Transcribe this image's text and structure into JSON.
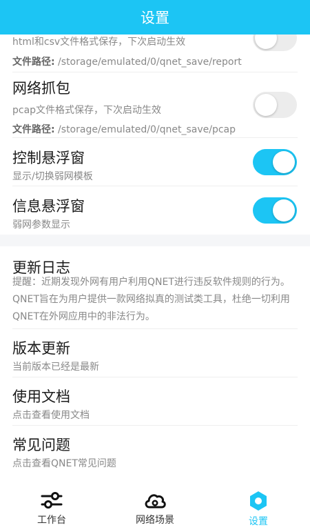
{
  "header": {
    "title": "设置"
  },
  "settings": {
    "report": {
      "desc": "html和csv文件格式保存，下次启动生效",
      "path_label": "文件路径:",
      "path_value": " /storage/emulated/0/qnet_save/report",
      "enabled": false
    },
    "capture": {
      "title": "网络抓包",
      "desc": "pcap文件格式保存，下次启动生效",
      "path_label": "文件路径:",
      "path_value": " /storage/emulated/0/qnet_save/pcap",
      "enabled": false
    },
    "control_float": {
      "title": "控制悬浮窗",
      "desc": "显示/切换弱网模板",
      "enabled": true
    },
    "info_float": {
      "title": "信息悬浮窗",
      "desc": "弱网参数显示",
      "enabled": true
    }
  },
  "about": {
    "changelog": {
      "title": "更新日志",
      "desc": "提醒：近期发现外网有用户利用QNET进行违反软件规则的行为。QNET旨在为用户提供一款网络拟真的测试类工具，杜绝一切利用QNET在外网应用中的非法行为。"
    },
    "version": {
      "title": "版本更新",
      "desc": "当前版本已经是最新"
    },
    "docs": {
      "title": "使用文档",
      "desc": "点击查看使用文档"
    },
    "faq": {
      "title": "常见问题",
      "desc": "点击查看QNET常见问题"
    }
  },
  "tabbar": {
    "workbench": {
      "label": "工作台",
      "icon": "sliders-icon"
    },
    "scenes": {
      "label": "网络场景",
      "icon": "cloud-icon"
    },
    "settings": {
      "label": "设置",
      "icon": "hexagon-gear-icon",
      "active": true
    }
  },
  "colors": {
    "accent": "#1cc5f4",
    "toggle_off": "#ececec",
    "section_gap": "#f5f6f8"
  }
}
